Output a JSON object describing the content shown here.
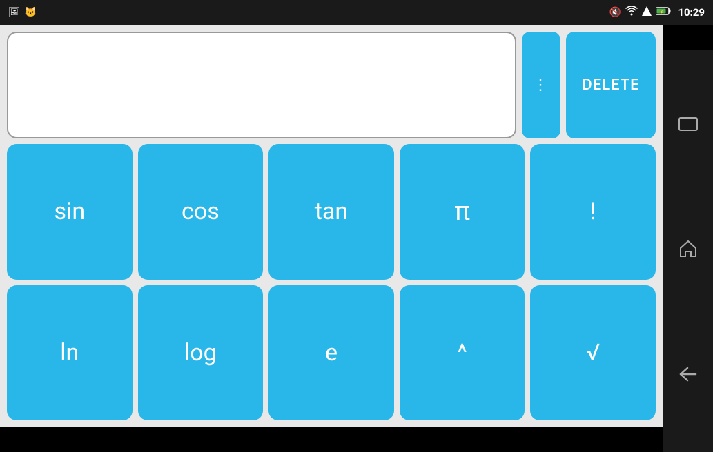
{
  "status": {
    "time": "10:29",
    "icons": {
      "mute": "🔇",
      "wifi": "WiFi",
      "signal": "▲",
      "battery": "⚡"
    }
  },
  "display": {
    "value": "",
    "placeholder": ""
  },
  "buttons": {
    "dots_label": "⋮",
    "delete_label": "DELETE",
    "row1": [
      {
        "id": "sin",
        "label": "sin"
      },
      {
        "id": "cos",
        "label": "cos"
      },
      {
        "id": "tan",
        "label": "tan"
      },
      {
        "id": "pi",
        "label": "π"
      },
      {
        "id": "factorial",
        "label": "!"
      }
    ],
    "row2": [
      {
        "id": "ln",
        "label": "ln"
      },
      {
        "id": "log",
        "label": "log"
      },
      {
        "id": "e",
        "label": "e"
      },
      {
        "id": "power",
        "label": "^"
      },
      {
        "id": "sqrt",
        "label": "√"
      }
    ]
  },
  "nav": {
    "expand": "⬜",
    "home": "⌂",
    "back": "←"
  }
}
